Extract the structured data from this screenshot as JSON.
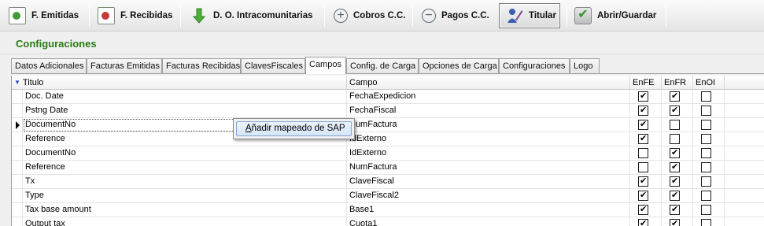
{
  "toolbar": {
    "buttons": [
      {
        "label": "F. Emitidas",
        "icon": "invoice-issued-icon"
      },
      {
        "label": "F. Recibidas",
        "icon": "invoice-received-icon"
      },
      {
        "label": "D. O. Intracomunitarias",
        "icon": "down-arrow-icon"
      },
      {
        "label": "Cobros C.C.",
        "icon": "plus-circle-icon"
      },
      {
        "label": "Pagos C.C.",
        "icon": "minus-circle-icon"
      },
      {
        "label": "Titular",
        "icon": "user-pen-icon"
      },
      {
        "label": "Abrir/Guardar",
        "icon": "check-save-icon"
      }
    ]
  },
  "section": {
    "title": "Configuraciones"
  },
  "tabs": [
    {
      "label": "Datos Adicionales"
    },
    {
      "label": "Facturas Emitidas"
    },
    {
      "label": "Facturas Recibidas"
    },
    {
      "label": "ClavesFiscales"
    },
    {
      "label": "Campos",
      "active": true
    },
    {
      "label": "Config. de Carga"
    },
    {
      "label": "Opciones de Carga"
    },
    {
      "label": "Configuraciones"
    },
    {
      "label": "Logo"
    }
  ],
  "grid": {
    "columns": {
      "titulo": "Titulo",
      "campo": "Campo",
      "enfe": "EnFE",
      "enfr": "EnFR",
      "enoi": "EnOI"
    },
    "rows": [
      {
        "titulo": "Doc. Date",
        "campo": "FechaExpedicion",
        "enfe": true,
        "enfr": true,
        "enoi": false
      },
      {
        "titulo": "Pstng Date",
        "campo": "FechaFiscal",
        "enfe": true,
        "enfr": true,
        "enoi": false
      },
      {
        "titulo": "DocumentNo",
        "campo": "NumFactura",
        "enfe": true,
        "enfr": false,
        "enoi": false,
        "current": true
      },
      {
        "titulo": "Reference",
        "campo": "IdExterno",
        "enfe": true,
        "enfr": false,
        "enoi": false
      },
      {
        "titulo": "DocumentNo",
        "campo": "IdExterno",
        "enfe": false,
        "enfr": true,
        "enoi": false
      },
      {
        "titulo": "Reference",
        "campo": "NumFactura",
        "enfe": false,
        "enfr": true,
        "enoi": false
      },
      {
        "titulo": "Tx",
        "campo": "ClaveFiscal",
        "enfe": true,
        "enfr": true,
        "enoi": false
      },
      {
        "titulo": "Type",
        "campo": "ClaveFiscal2",
        "enfe": true,
        "enfr": true,
        "enoi": false
      },
      {
        "titulo": "Tax base amount",
        "campo": "Base1",
        "enfe": true,
        "enfr": true,
        "enoi": false
      },
      {
        "titulo": "Output tax",
        "campo": "Cuota1",
        "enfe": true,
        "enfr": true,
        "enoi": false
      }
    ]
  },
  "context_menu": {
    "item_label": "Añadir mapeado de SAP"
  }
}
